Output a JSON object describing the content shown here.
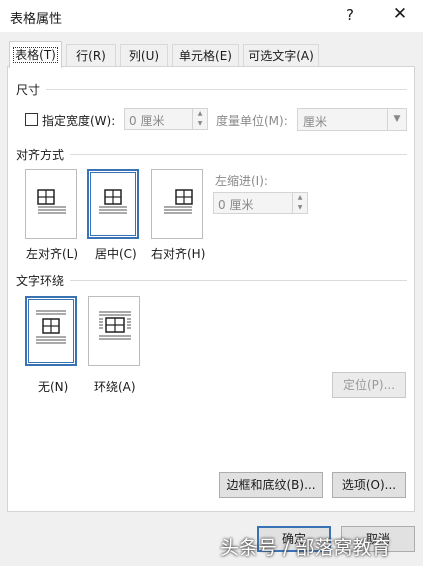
{
  "window": {
    "title": "表格属性",
    "help": "?",
    "close": "✕"
  },
  "tabs": [
    {
      "label": "表格(T)",
      "active": true
    },
    {
      "label": "行(R)"
    },
    {
      "label": "列(U)"
    },
    {
      "label": "单元格(E)"
    },
    {
      "label": "可选文字(A)"
    }
  ],
  "size": {
    "heading": "尺寸",
    "specify_width_label": "指定宽度(W):",
    "specify_width_checked": false,
    "width_value": "0 厘米",
    "measure_label": "度量单位(M):",
    "measure_value": "厘米"
  },
  "alignment": {
    "heading": "对齐方式",
    "options": [
      {
        "label": "左对齐(L)",
        "selected": false
      },
      {
        "label": "居中(C)",
        "selected": true
      },
      {
        "label": "右对齐(H)",
        "selected": false
      }
    ],
    "indent_label": "左缩进(I):",
    "indent_value": "0 厘米"
  },
  "wrapping": {
    "heading": "文字环绕",
    "options": [
      {
        "label": "无(N)",
        "selected": true
      },
      {
        "label": "环绕(A)",
        "selected": false
      }
    ],
    "position_button": "定位(P)..."
  },
  "buttons": {
    "borders": "边框和底纹(B)...",
    "options": "选项(O)...",
    "ok": "确定",
    "cancel": "取消"
  },
  "watermark": "头条号 / 部落窝教育",
  "colors": {
    "accent": "#3a73b5",
    "panel": "#ffffff",
    "dialog": "#f0f0f0"
  }
}
